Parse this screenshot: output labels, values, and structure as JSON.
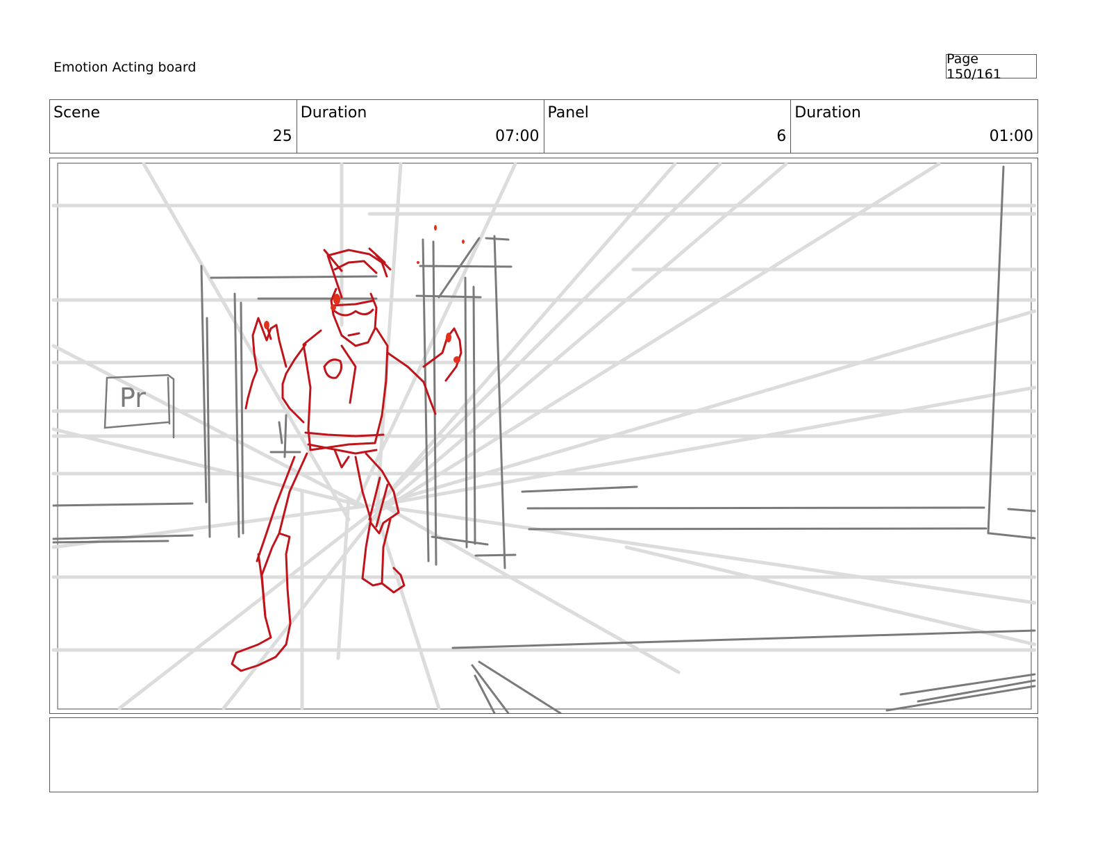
{
  "header": {
    "title": "Emotion Acting board",
    "page_label": "Page 150/161"
  },
  "info": {
    "scene_label": "Scene",
    "scene_value": "25",
    "scene_duration_label": "Duration",
    "scene_duration_value": "07:00",
    "panel_label": "Panel",
    "panel_value": "6",
    "panel_duration_label": "Duration",
    "panel_duration_value": "01:00"
  },
  "panel": {
    "sign_text": "Pr"
  },
  "notes": {
    "text": ""
  },
  "colors": {
    "border": "#555555",
    "guide_light": "#dcdcdc",
    "sketch_grey": "#7a7a7a",
    "character_red": "#c0141b"
  }
}
